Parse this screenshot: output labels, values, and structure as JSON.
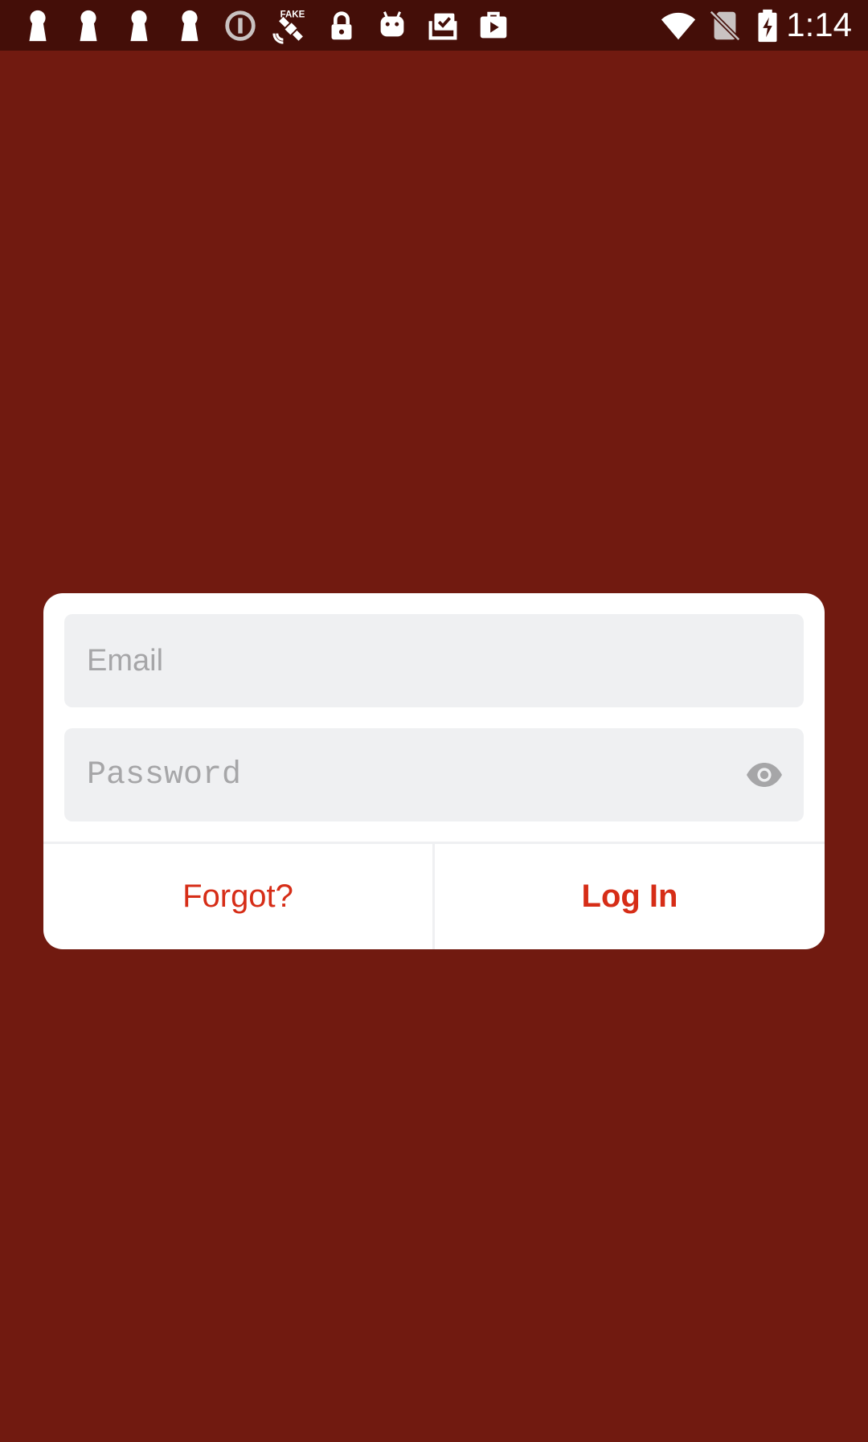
{
  "status_bar": {
    "time": "1:14",
    "left_icons": [
      "keyhole-icon",
      "keyhole-icon",
      "keyhole-icon",
      "keyhole-icon",
      "alert-circle-icon",
      "fake-gps-satellite-icon",
      "lock-icon",
      "android-icon",
      "briefcase-check-icon",
      "briefcase-play-icon"
    ],
    "right_icons": [
      "wifi-icon",
      "no-sim-icon",
      "battery-charging-icon"
    ]
  },
  "login_form": {
    "email_placeholder": "Email",
    "password_placeholder": "Password",
    "forgot_label": "Forgot?",
    "login_label": "Log In"
  },
  "colors": {
    "background": "#711a10",
    "status_bar": "#440e08",
    "card": "#ffffff",
    "field": "#eff0f2",
    "accent": "#d62d17",
    "placeholder": "#a6a6a8"
  }
}
